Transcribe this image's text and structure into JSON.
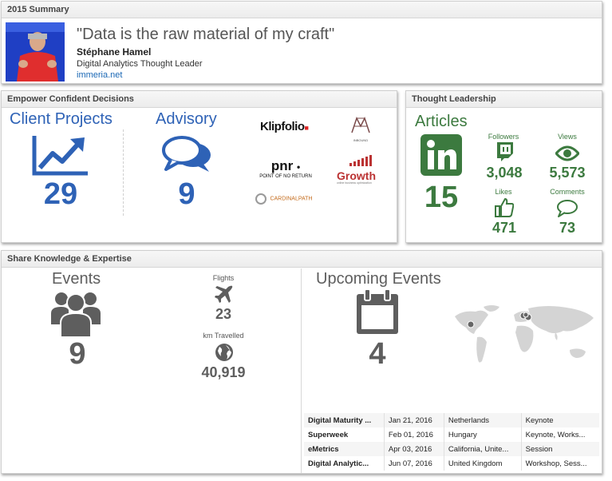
{
  "summary": {
    "title": "2015 Summary",
    "quote": "\"Data is the raw material of my craft\"",
    "name": "Stéphane Hamel",
    "role": "Digital Analytics Thought Leader",
    "website": "immeria.net"
  },
  "decisions": {
    "title": "Empower Confident Decisions",
    "client_projects": {
      "label": "Client Projects",
      "value": "29"
    },
    "advisory": {
      "label": "Advisory",
      "value": "9"
    },
    "logos": {
      "klipfolio": "Klipfolio",
      "inbound": "INBOUND",
      "pnr": "pnr",
      "pnr_sub": "POINT OF NO RETURN",
      "growth": "Growth",
      "growth_sub": "online business optimization",
      "cardinal": "CARDINALPATH"
    }
  },
  "thought": {
    "title": "Thought Leadership",
    "articles_label": "Articles",
    "articles_value": "15",
    "followers": {
      "label": "Followers",
      "value": "3,048"
    },
    "views": {
      "label": "Views",
      "value": "5,573"
    },
    "likes": {
      "label": "Likes",
      "value": "471"
    },
    "comments": {
      "label": "Comments",
      "value": "73"
    }
  },
  "share": {
    "title": "Share Knowledge & Expertise",
    "events": {
      "label": "Events",
      "value": "9"
    },
    "flights": {
      "label": "Flights",
      "value": "23"
    },
    "km": {
      "label": "km Travelled",
      "value": "40,919"
    },
    "upcoming": {
      "label": "Upcoming Events",
      "value": "4"
    },
    "table": [
      {
        "name": "Digital Maturity ...",
        "date": "Jan 21, 2016",
        "place": "Netherlands",
        "type": "Keynote"
      },
      {
        "name": "Superweek",
        "date": "Feb 01, 2016",
        "place": "Hungary",
        "type": "Keynote, Works..."
      },
      {
        "name": "eMetrics",
        "date": "Apr 03, 2016",
        "place": "California, Unite...",
        "type": "Session"
      },
      {
        "name": "Digital Analytic...",
        "date": "Jun 07, 2016",
        "place": "United Kingdom",
        "type": "Workshop, Sess..."
      }
    ]
  },
  "colors": {
    "blue": "#2e62b6",
    "green": "#3c7a3f",
    "grey": "#5e5e5e"
  },
  "icons": [
    "trend-chart-icon",
    "chat-bubbles-icon",
    "linkedin-icon",
    "twitch-icon",
    "eye-icon",
    "thumbs-up-icon",
    "comment-icon",
    "people-group-icon",
    "airplane-icon",
    "globe-icon",
    "calendar-icon",
    "world-map-icon"
  ]
}
